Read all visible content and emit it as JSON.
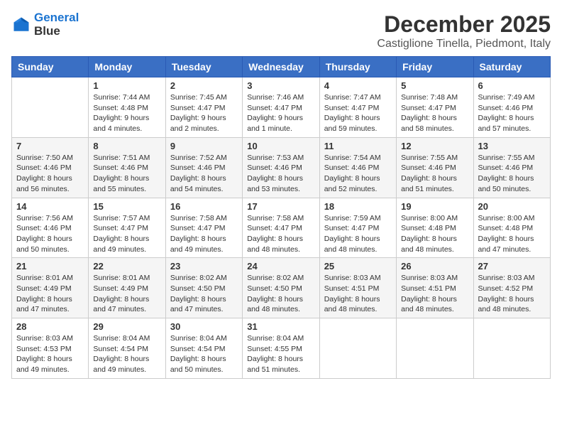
{
  "logo": {
    "line1": "General",
    "line2": "Blue"
  },
  "title": "December 2025",
  "location": "Castiglione Tinella, Piedmont, Italy",
  "weekdays": [
    "Sunday",
    "Monday",
    "Tuesday",
    "Wednesday",
    "Thursday",
    "Friday",
    "Saturday"
  ],
  "weeks": [
    [
      {
        "day": "",
        "sunrise": "",
        "sunset": "",
        "daylight": ""
      },
      {
        "day": "1",
        "sunrise": "Sunrise: 7:44 AM",
        "sunset": "Sunset: 4:48 PM",
        "daylight": "Daylight: 9 hours and 4 minutes."
      },
      {
        "day": "2",
        "sunrise": "Sunrise: 7:45 AM",
        "sunset": "Sunset: 4:47 PM",
        "daylight": "Daylight: 9 hours and 2 minutes."
      },
      {
        "day": "3",
        "sunrise": "Sunrise: 7:46 AM",
        "sunset": "Sunset: 4:47 PM",
        "daylight": "Daylight: 9 hours and 1 minute."
      },
      {
        "day": "4",
        "sunrise": "Sunrise: 7:47 AM",
        "sunset": "Sunset: 4:47 PM",
        "daylight": "Daylight: 8 hours and 59 minutes."
      },
      {
        "day": "5",
        "sunrise": "Sunrise: 7:48 AM",
        "sunset": "Sunset: 4:47 PM",
        "daylight": "Daylight: 8 hours and 58 minutes."
      },
      {
        "day": "6",
        "sunrise": "Sunrise: 7:49 AM",
        "sunset": "Sunset: 4:46 PM",
        "daylight": "Daylight: 8 hours and 57 minutes."
      }
    ],
    [
      {
        "day": "7",
        "sunrise": "Sunrise: 7:50 AM",
        "sunset": "Sunset: 4:46 PM",
        "daylight": "Daylight: 8 hours and 56 minutes."
      },
      {
        "day": "8",
        "sunrise": "Sunrise: 7:51 AM",
        "sunset": "Sunset: 4:46 PM",
        "daylight": "Daylight: 8 hours and 55 minutes."
      },
      {
        "day": "9",
        "sunrise": "Sunrise: 7:52 AM",
        "sunset": "Sunset: 4:46 PM",
        "daylight": "Daylight: 8 hours and 54 minutes."
      },
      {
        "day": "10",
        "sunrise": "Sunrise: 7:53 AM",
        "sunset": "Sunset: 4:46 PM",
        "daylight": "Daylight: 8 hours and 53 minutes."
      },
      {
        "day": "11",
        "sunrise": "Sunrise: 7:54 AM",
        "sunset": "Sunset: 4:46 PM",
        "daylight": "Daylight: 8 hours and 52 minutes."
      },
      {
        "day": "12",
        "sunrise": "Sunrise: 7:55 AM",
        "sunset": "Sunset: 4:46 PM",
        "daylight": "Daylight: 8 hours and 51 minutes."
      },
      {
        "day": "13",
        "sunrise": "Sunrise: 7:55 AM",
        "sunset": "Sunset: 4:46 PM",
        "daylight": "Daylight: 8 hours and 50 minutes."
      }
    ],
    [
      {
        "day": "14",
        "sunrise": "Sunrise: 7:56 AM",
        "sunset": "Sunset: 4:46 PM",
        "daylight": "Daylight: 8 hours and 50 minutes."
      },
      {
        "day": "15",
        "sunrise": "Sunrise: 7:57 AM",
        "sunset": "Sunset: 4:47 PM",
        "daylight": "Daylight: 8 hours and 49 minutes."
      },
      {
        "day": "16",
        "sunrise": "Sunrise: 7:58 AM",
        "sunset": "Sunset: 4:47 PM",
        "daylight": "Daylight: 8 hours and 49 minutes."
      },
      {
        "day": "17",
        "sunrise": "Sunrise: 7:58 AM",
        "sunset": "Sunset: 4:47 PM",
        "daylight": "Daylight: 8 hours and 48 minutes."
      },
      {
        "day": "18",
        "sunrise": "Sunrise: 7:59 AM",
        "sunset": "Sunset: 4:47 PM",
        "daylight": "Daylight: 8 hours and 48 minutes."
      },
      {
        "day": "19",
        "sunrise": "Sunrise: 8:00 AM",
        "sunset": "Sunset: 4:48 PM",
        "daylight": "Daylight: 8 hours and 48 minutes."
      },
      {
        "day": "20",
        "sunrise": "Sunrise: 8:00 AM",
        "sunset": "Sunset: 4:48 PM",
        "daylight": "Daylight: 8 hours and 47 minutes."
      }
    ],
    [
      {
        "day": "21",
        "sunrise": "Sunrise: 8:01 AM",
        "sunset": "Sunset: 4:49 PM",
        "daylight": "Daylight: 8 hours and 47 minutes."
      },
      {
        "day": "22",
        "sunrise": "Sunrise: 8:01 AM",
        "sunset": "Sunset: 4:49 PM",
        "daylight": "Daylight: 8 hours and 47 minutes."
      },
      {
        "day": "23",
        "sunrise": "Sunrise: 8:02 AM",
        "sunset": "Sunset: 4:50 PM",
        "daylight": "Daylight: 8 hours and 47 minutes."
      },
      {
        "day": "24",
        "sunrise": "Sunrise: 8:02 AM",
        "sunset": "Sunset: 4:50 PM",
        "daylight": "Daylight: 8 hours and 48 minutes."
      },
      {
        "day": "25",
        "sunrise": "Sunrise: 8:03 AM",
        "sunset": "Sunset: 4:51 PM",
        "daylight": "Daylight: 8 hours and 48 minutes."
      },
      {
        "day": "26",
        "sunrise": "Sunrise: 8:03 AM",
        "sunset": "Sunset: 4:51 PM",
        "daylight": "Daylight: 8 hours and 48 minutes."
      },
      {
        "day": "27",
        "sunrise": "Sunrise: 8:03 AM",
        "sunset": "Sunset: 4:52 PM",
        "daylight": "Daylight: 8 hours and 48 minutes."
      }
    ],
    [
      {
        "day": "28",
        "sunrise": "Sunrise: 8:03 AM",
        "sunset": "Sunset: 4:53 PM",
        "daylight": "Daylight: 8 hours and 49 minutes."
      },
      {
        "day": "29",
        "sunrise": "Sunrise: 8:04 AM",
        "sunset": "Sunset: 4:54 PM",
        "daylight": "Daylight: 8 hours and 49 minutes."
      },
      {
        "day": "30",
        "sunrise": "Sunrise: 8:04 AM",
        "sunset": "Sunset: 4:54 PM",
        "daylight": "Daylight: 8 hours and 50 minutes."
      },
      {
        "day": "31",
        "sunrise": "Sunrise: 8:04 AM",
        "sunset": "Sunset: 4:55 PM",
        "daylight": "Daylight: 8 hours and 51 minutes."
      },
      {
        "day": "",
        "sunrise": "",
        "sunset": "",
        "daylight": ""
      },
      {
        "day": "",
        "sunrise": "",
        "sunset": "",
        "daylight": ""
      },
      {
        "day": "",
        "sunrise": "",
        "sunset": "",
        "daylight": ""
      }
    ]
  ]
}
